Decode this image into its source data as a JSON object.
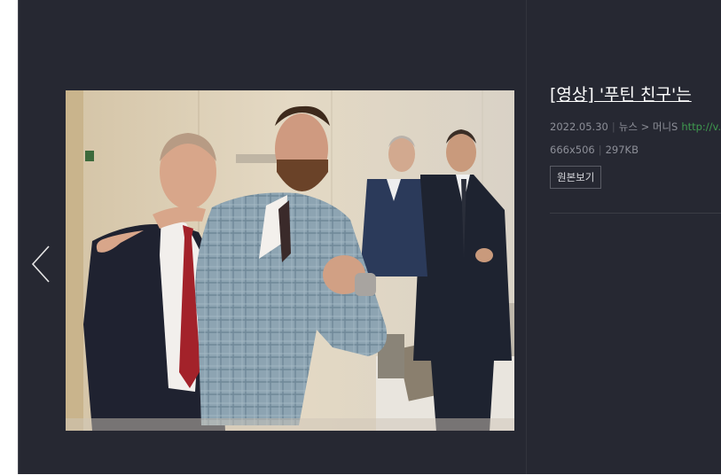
{
  "viewer": {
    "prev_icon": "chevron-left-icon",
    "title": "[영상] '푸틴 친구'는",
    "date": "2022.05.30",
    "category": "뉴스",
    "breadcrumb_sep": ">",
    "source": "머니S",
    "link": "http://v.",
    "dimensions": "666x506",
    "file_size": "297KB",
    "original_button": "원본보기"
  },
  "colors": {
    "background": "#262832",
    "link": "#3f9a4f",
    "meta_text": "#8d8f98"
  }
}
